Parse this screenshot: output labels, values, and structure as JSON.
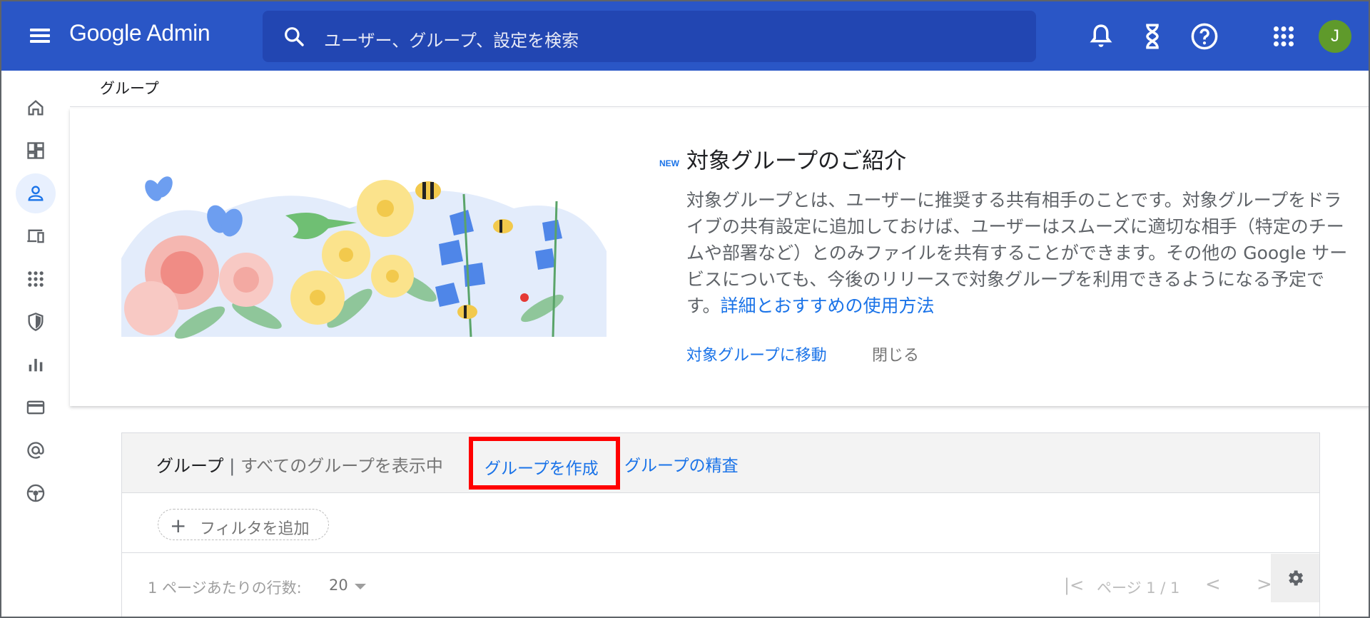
{
  "header": {
    "logo": "Google Admin",
    "search_placeholder": "ユーザー、グループ、設定を検索",
    "avatar_initial": "J",
    "avatar_color": "#5f9a2b",
    "brand_color": "#2a56c6"
  },
  "rail": {
    "items": [
      {
        "icon": "home-icon"
      },
      {
        "icon": "dashboard-icon"
      },
      {
        "icon": "user-icon",
        "active": true
      },
      {
        "icon": "devices-icon"
      },
      {
        "icon": "apps-icon"
      },
      {
        "icon": "security-shield-icon"
      },
      {
        "icon": "reports-icon"
      },
      {
        "icon": "billing-icon"
      },
      {
        "icon": "domain-at-icon"
      },
      {
        "icon": "support-icon"
      }
    ]
  },
  "breadcrumb": "グループ",
  "promo": {
    "badge": "NEW",
    "title": "対象グループのご紹介",
    "body": "対象グループとは、ユーザーに推奨する共有相手のことです。対象グループをドライブの共有設定に追加しておけば、ユーザーはスムーズに適切な相手（特定のチームや部署など）とのみファイルを共有することができます。その他の Google サービスについても、今後のリリースで対象グループを利用できるようになる予定です。",
    "link": "詳細とおすすめの使用方法",
    "action_go": "対象グループに移動",
    "action_close": "閉じる"
  },
  "groups": {
    "title": "グループ",
    "separator": "|",
    "subtitle": "すべてのグループを表示中",
    "create_label": "グループを作成",
    "audit_label": "グループの精査",
    "filter_label": "フィルタを追加",
    "rows_per_page_label": "1 ページあたりの行数:",
    "rows_per_page_value": "20",
    "page_label": "ページ 1 / 1",
    "highlight_color": "#ff0000"
  }
}
